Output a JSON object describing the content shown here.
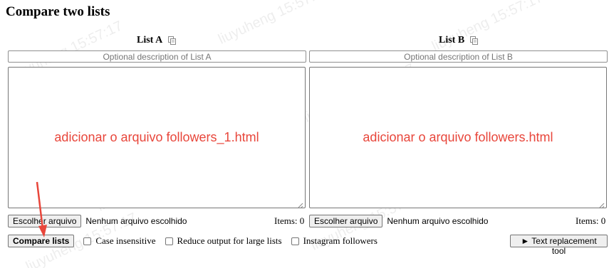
{
  "page": {
    "title": "Compare two lists"
  },
  "list_a": {
    "heading": "List A",
    "description": "Optional description of List A",
    "content": "",
    "annotation": "adicionar o arquivo followers_1.html",
    "choose_file_label": "Escolher arquivo",
    "file_status": "Nenhum arquivo escolhido",
    "items_label": "Items: 0"
  },
  "list_b": {
    "heading": "List B",
    "description": "Optional description of List B",
    "content": "",
    "annotation": "adicionar o arquivo followers.html",
    "choose_file_label": "Escolher arquivo",
    "file_status": "Nenhum arquivo escolhido",
    "items_label": "Items: 0"
  },
  "controls": {
    "compare_label": "Compare lists",
    "case_insensitive_label": "Case insensitive",
    "case_insensitive_checked": false,
    "reduce_output_label": "Reduce output for large lists",
    "reduce_output_checked": false,
    "instagram_label": "Instagram followers",
    "instagram_checked": false,
    "text_replacement_label": "► Text replacement tool"
  },
  "watermark": {
    "text": "liuyuheng 15:57:17"
  },
  "icons": {
    "copy": "copy-icon",
    "resize": "resize-grip-icon",
    "annotation_arrow": "arrow-icon"
  },
  "colors": {
    "annotation": "#e8463b",
    "button_bg": "#efefef",
    "border": "#767676"
  }
}
